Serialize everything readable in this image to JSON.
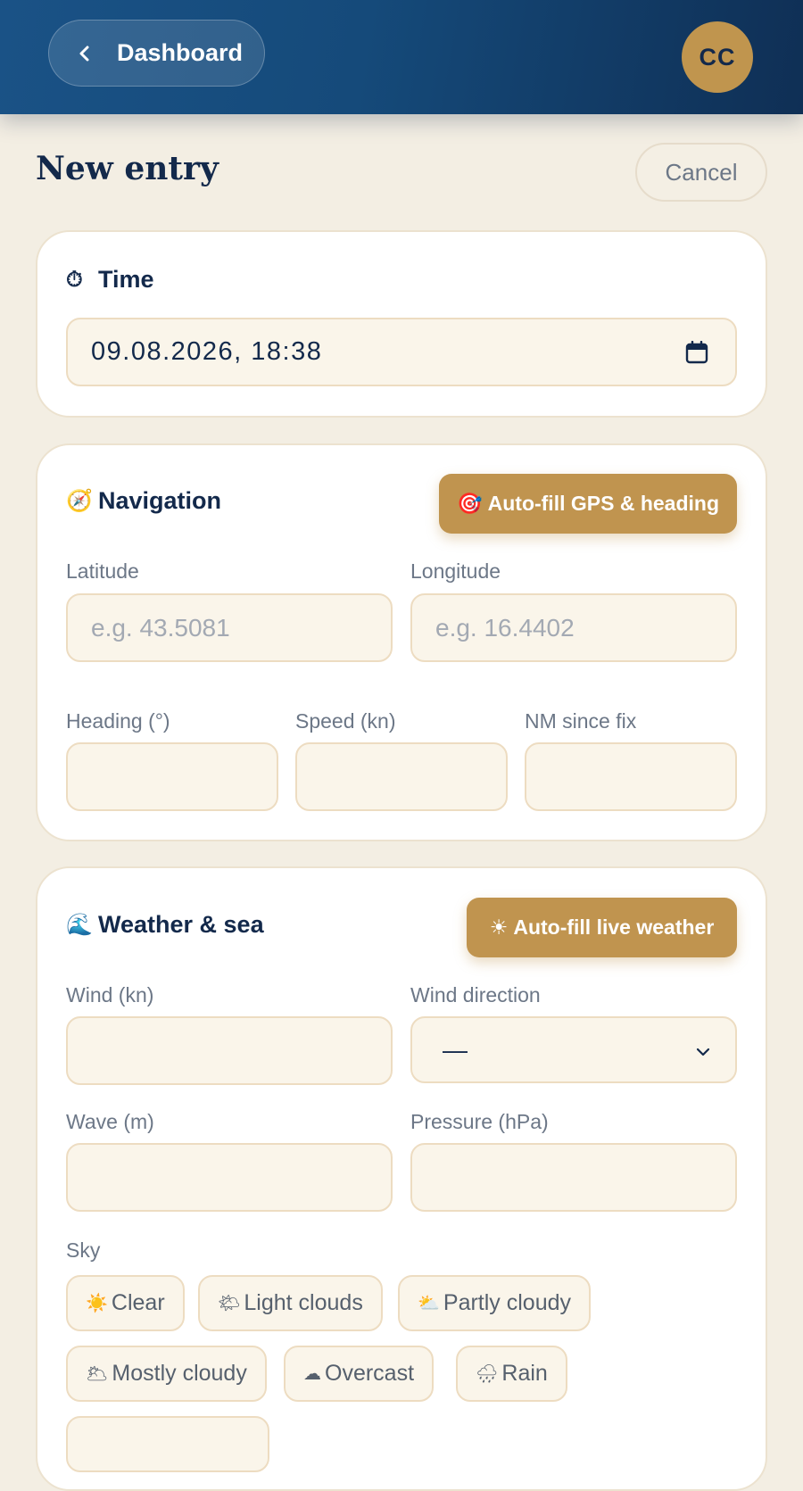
{
  "header": {
    "back_label": "Dashboard",
    "avatar_initials": "CC"
  },
  "page": {
    "title": "New entry",
    "cancel_label": "Cancel"
  },
  "time_card": {
    "icon": "⏱",
    "title": "Time",
    "datetime_value": "09.08.2026, 18:38"
  },
  "navigation_card": {
    "icon": "🧭",
    "title": "Navigation",
    "autofill_icon": "🎯",
    "autofill_label": "Auto-fill GPS & heading",
    "latitude_label": "Latitude",
    "latitude_placeholder": "e.g. 43.5081",
    "longitude_label": "Longitude",
    "longitude_placeholder": "e.g. 16.4402",
    "heading_label": "Heading (°)",
    "speed_label": "Speed (kn)",
    "nm_label": "NM since fix"
  },
  "weather_card": {
    "icon": "🌊",
    "title": "Weather & sea",
    "autofill_icon": "☀",
    "autofill_label": "Auto-fill live weather",
    "wind_label": "Wind (kn)",
    "wind_direction_label": "Wind direction",
    "wind_direction_value": "—",
    "wave_label": "Wave (m)",
    "pressure_label": "Pressure (hPa)",
    "sky_label": "Sky",
    "sky_options": [
      {
        "icon": "☀️",
        "label": "Clear"
      },
      {
        "icon": "🌤",
        "label": "Light clouds"
      },
      {
        "icon": "⛅",
        "label": "Partly cloudy"
      },
      {
        "icon": "🌥",
        "label": "Mostly cloudy"
      },
      {
        "icon": "☁",
        "label": "Overcast"
      },
      {
        "icon": "🌧",
        "label": "Rain"
      }
    ]
  }
}
